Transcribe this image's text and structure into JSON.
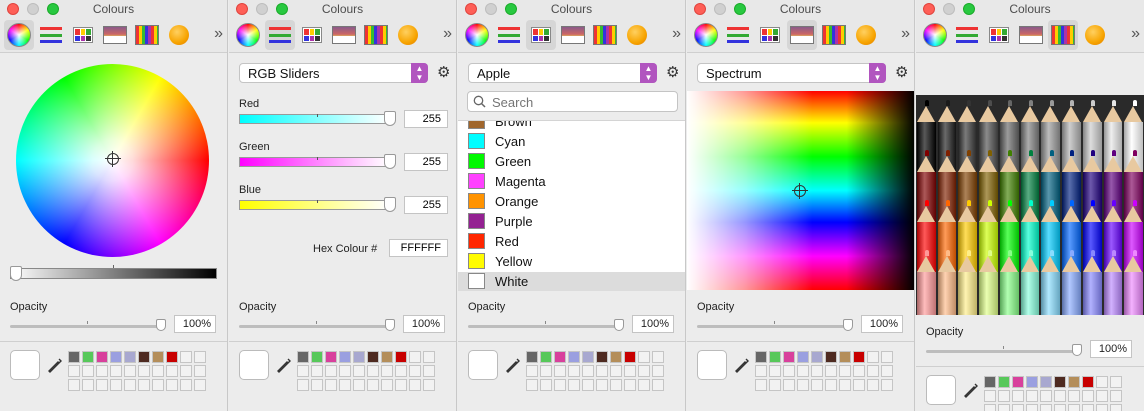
{
  "window_title": "Colours",
  "more_glyph": "»",
  "opacity": {
    "label": "Opacity",
    "value": "100%"
  },
  "swatch_colors": [
    "#666666",
    "#57c85a",
    "#d8409c",
    "#9a9fe0",
    "#a8a8d0",
    "#4e2a20",
    "#b48e5a",
    "#c80000"
  ],
  "wheel": {
    "brightness_level": 0.0
  },
  "rgb": {
    "mode": "RGB Sliders",
    "sliders": [
      {
        "label": "Red",
        "value": "255",
        "level": 1.0,
        "color_from": "#00ffff",
        "color_to": "#ffffff"
      },
      {
        "label": "Green",
        "value": "255",
        "level": 1.0,
        "color_from": "#ff00ff",
        "color_to": "#ffffff"
      },
      {
        "label": "Blue",
        "value": "255",
        "level": 1.0,
        "color_from": "#ffff00",
        "color_to": "#ffffff"
      }
    ],
    "hex_label": "Hex Colour #",
    "hex_value": "FFFFFF"
  },
  "palette": {
    "name": "Apple",
    "search_placeholder": "Search",
    "items": [
      {
        "name": "Brown",
        "color": "#a0662c"
      },
      {
        "name": "Cyan",
        "color": "#00fdff"
      },
      {
        "name": "Green",
        "color": "#00f900"
      },
      {
        "name": "Magenta",
        "color": "#ff40ff"
      },
      {
        "name": "Orange",
        "color": "#ff9300"
      },
      {
        "name": "Purple",
        "color": "#942192"
      },
      {
        "name": "Red",
        "color": "#ff2600"
      },
      {
        "name": "Yellow",
        "color": "#fffb00"
      },
      {
        "name": "White",
        "color": "#ffffff"
      }
    ],
    "selected": "White"
  },
  "spectrum": {
    "name": "Spectrum"
  },
  "pencils": {
    "colors_row1": [
      "#000000",
      "#1a1a1a",
      "#333333",
      "#4d4d4d",
      "#666666",
      "#808080",
      "#999999",
      "#b3b3b3",
      "#cccccc",
      "#e6e6e6",
      "#ffffff"
    ],
    "colors_row2": [
      "#800000",
      "#802000",
      "#804000",
      "#806000",
      "#408000",
      "#008040",
      "#006080",
      "#002080",
      "#200080",
      "#600080",
      "#800060"
    ],
    "colors_row3": [
      "#ff0000",
      "#ff6600",
      "#ffcc00",
      "#ccff00",
      "#00ff00",
      "#00ffcc",
      "#00ccff",
      "#0066ff",
      "#0000ff",
      "#6600ff",
      "#cc00ff"
    ],
    "colors_row4": [
      "#ff9999",
      "#ffbb88",
      "#ffee88",
      "#dfff88",
      "#88ff88",
      "#88ffdd",
      "#88ddff",
      "#88aaff",
      "#8888ff",
      "#bb88ff",
      "#ee88ff"
    ]
  }
}
